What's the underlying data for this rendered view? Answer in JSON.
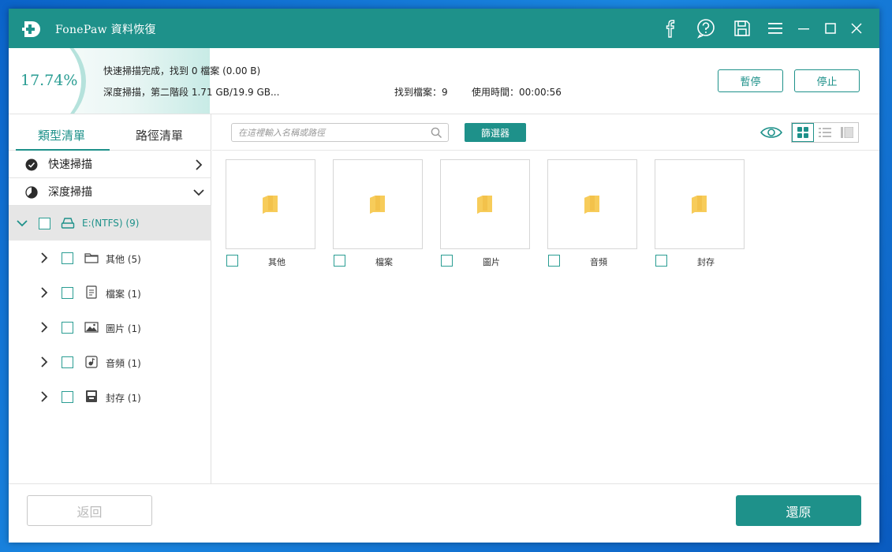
{
  "app": {
    "title": "FonePaw 資料恢復"
  },
  "colors": {
    "accent": "#1e918a",
    "folder": "#f3c24b"
  },
  "titlebar_icons": [
    "facebook-icon",
    "help-icon",
    "save-icon",
    "menu-icon",
    "minimize-icon",
    "maximize-icon",
    "close-icon"
  ],
  "scan": {
    "percent": "17.74%",
    "progress": 0.1774,
    "line1": "快速掃描完成，找到 0 檔案 (0.00 B)",
    "line2": "深度掃描，第二階段 1.71 GB/19.9 GB...",
    "found": "找到檔案：9",
    "elapsed": "使用時間：00:00:56",
    "pause_label": "暫停",
    "stop_label": "停止"
  },
  "sidebar": {
    "tabs": [
      {
        "label": "類型清單",
        "active": true
      },
      {
        "label": "路徑清單",
        "active": false
      }
    ],
    "quick_scan": "快速掃描",
    "deep_scan": "深度掃描",
    "drive": {
      "label": "E:(NTFS) (9)"
    },
    "tree": [
      {
        "label": "其他 (5)",
        "icon": "folder-icon"
      },
      {
        "label": "檔案 (1)",
        "icon": "document-icon"
      },
      {
        "label": "圖片 (1)",
        "icon": "image-icon"
      },
      {
        "label": "音頻 (1)",
        "icon": "audio-icon"
      },
      {
        "label": "封存 (1)",
        "icon": "archive-icon"
      }
    ]
  },
  "toolbar": {
    "search_placeholder": "在這裡輸入名稱或路徑",
    "filter_label": "篩選器"
  },
  "grid": {
    "tiles": [
      {
        "label": "其他"
      },
      {
        "label": "檔案"
      },
      {
        "label": "圖片"
      },
      {
        "label": "音頻"
      },
      {
        "label": "封存"
      }
    ]
  },
  "footer": {
    "back_label": "返回",
    "recover_label": "還原"
  }
}
